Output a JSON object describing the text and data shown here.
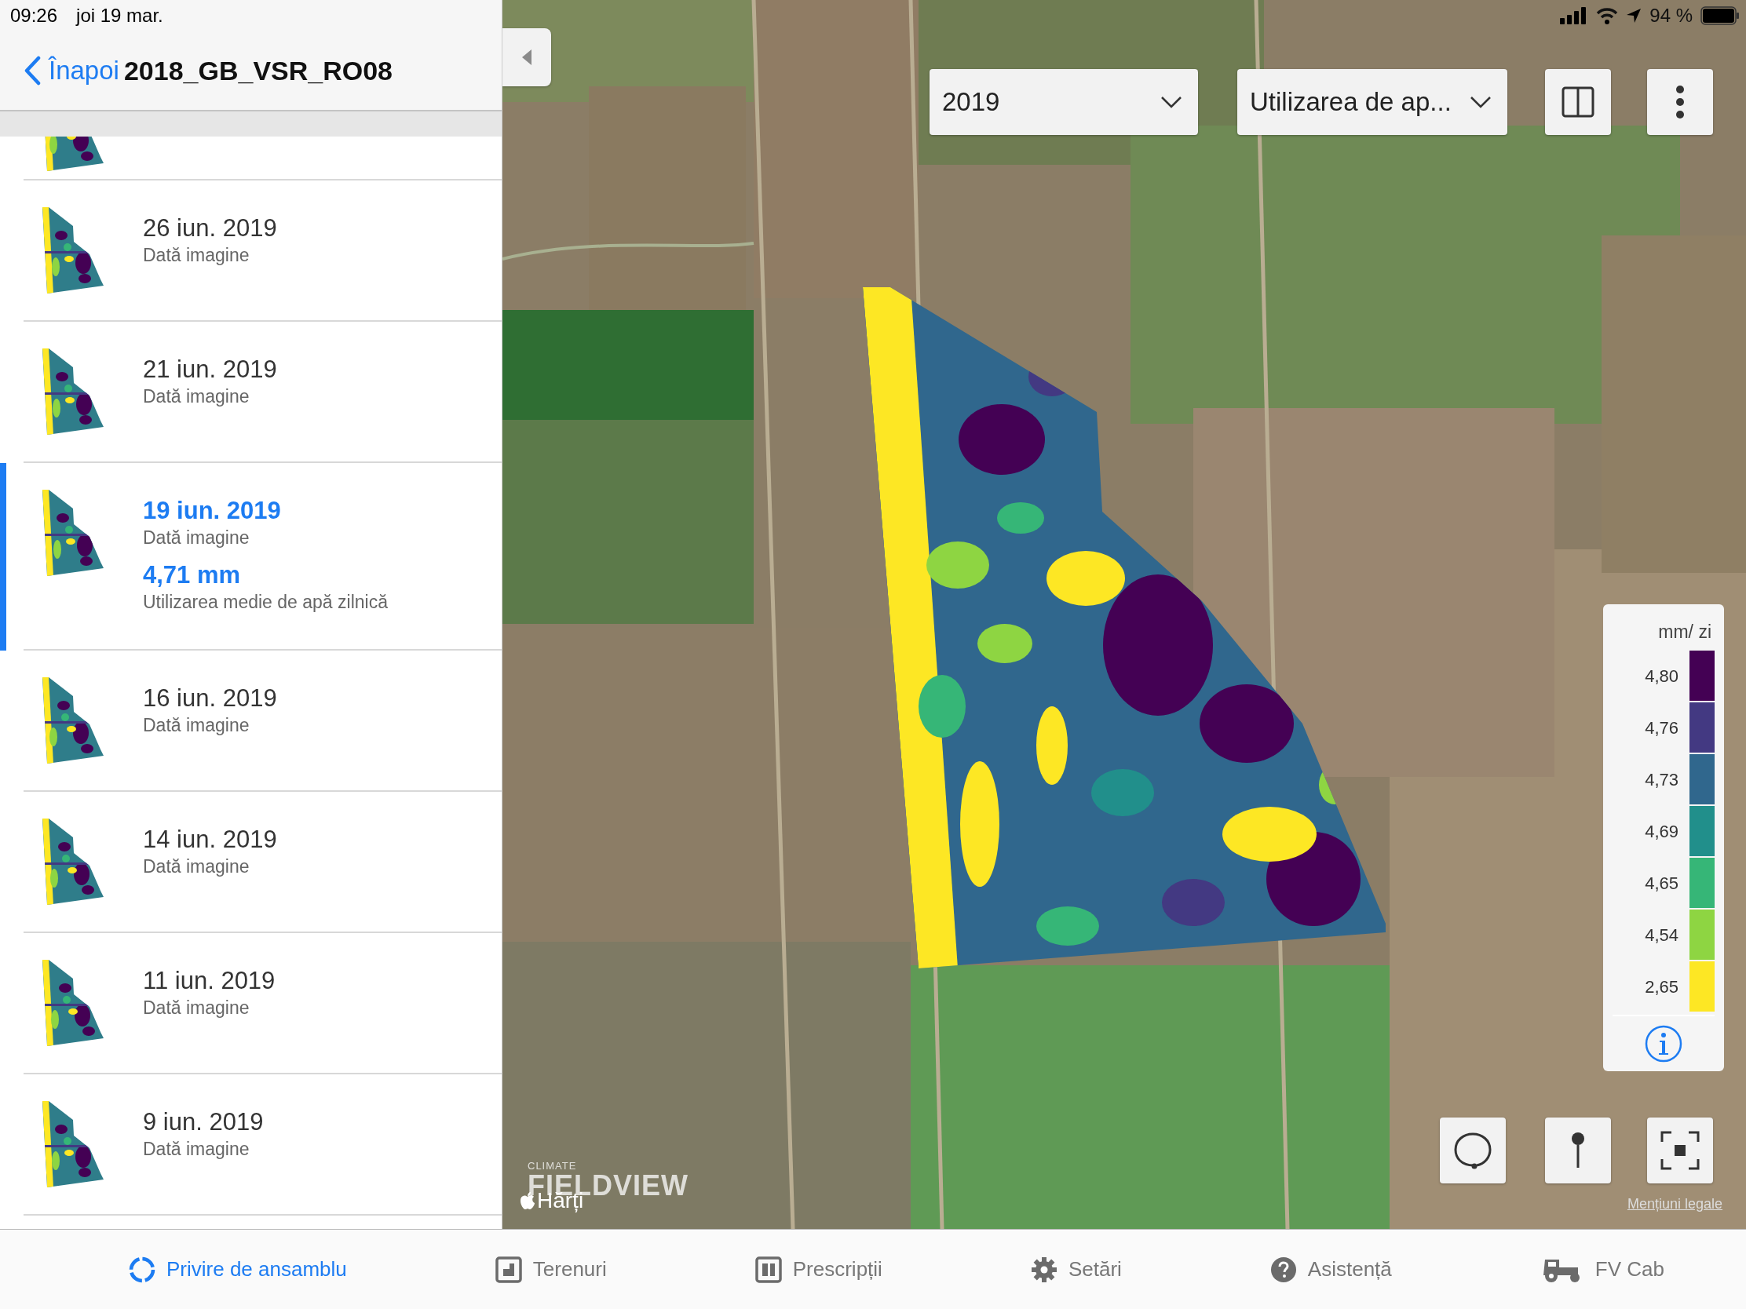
{
  "status_bar": {
    "time": "09:26",
    "date": "joi 19 mar.",
    "battery": "94 %"
  },
  "nav": {
    "back_label": "Înapoi",
    "title": "2018_GB_VSR_RO08"
  },
  "images": [
    {
      "date": "26 iun. 2019",
      "caption": "Dată imagine",
      "selected": false
    },
    {
      "date": "21 iun. 2019",
      "caption": "Dată imagine",
      "selected": false
    },
    {
      "date": "19 iun. 2019",
      "caption": "Dată imagine",
      "selected": true,
      "value": "4,71 mm",
      "value_caption": "Utilizarea medie de apă zilnică"
    },
    {
      "date": "16 iun. 2019",
      "caption": "Dată imagine",
      "selected": false
    },
    {
      "date": "14 iun. 2019",
      "caption": "Dată imagine",
      "selected": false
    },
    {
      "date": "11 iun. 2019",
      "caption": "Dată imagine",
      "selected": false
    },
    {
      "date": "9 iun. 2019",
      "caption": "Dată imagine",
      "selected": false
    }
  ],
  "map": {
    "year_dropdown": "2019",
    "layer_dropdown": "Utilizarea de ap...",
    "legend": {
      "unit": "mm/ zi",
      "bins": [
        {
          "label": "4,80",
          "color": "#440154"
        },
        {
          "label": "4,76",
          "color": "#433982"
        },
        {
          "label": "4,73",
          "color": "#30678d"
        },
        {
          "label": "4,69",
          "color": "#218f8b"
        },
        {
          "label": "4,65",
          "color": "#36b677"
        },
        {
          "label": "4,54",
          "color": "#8ed542"
        },
        {
          "label": "2,65",
          "color": "#fde724"
        }
      ]
    },
    "logo": {
      "top": "CLIMATE",
      "main": "FIELDVIEW"
    },
    "attribution": "Hărți",
    "legal": "Mențiuni legale"
  },
  "tabs": [
    {
      "label": "Privire de ansamblu",
      "kind": "overview",
      "selected": true
    },
    {
      "label": "Terenuri",
      "kind": "fields",
      "selected": false
    },
    {
      "label": "Prescripții",
      "kind": "prescriptions",
      "selected": false
    },
    {
      "label": "Setări",
      "kind": "settings",
      "selected": false
    },
    {
      "label": "Asistență",
      "kind": "help",
      "selected": false
    },
    {
      "label": "FV Cab",
      "kind": "tractor",
      "selected": false
    }
  ]
}
